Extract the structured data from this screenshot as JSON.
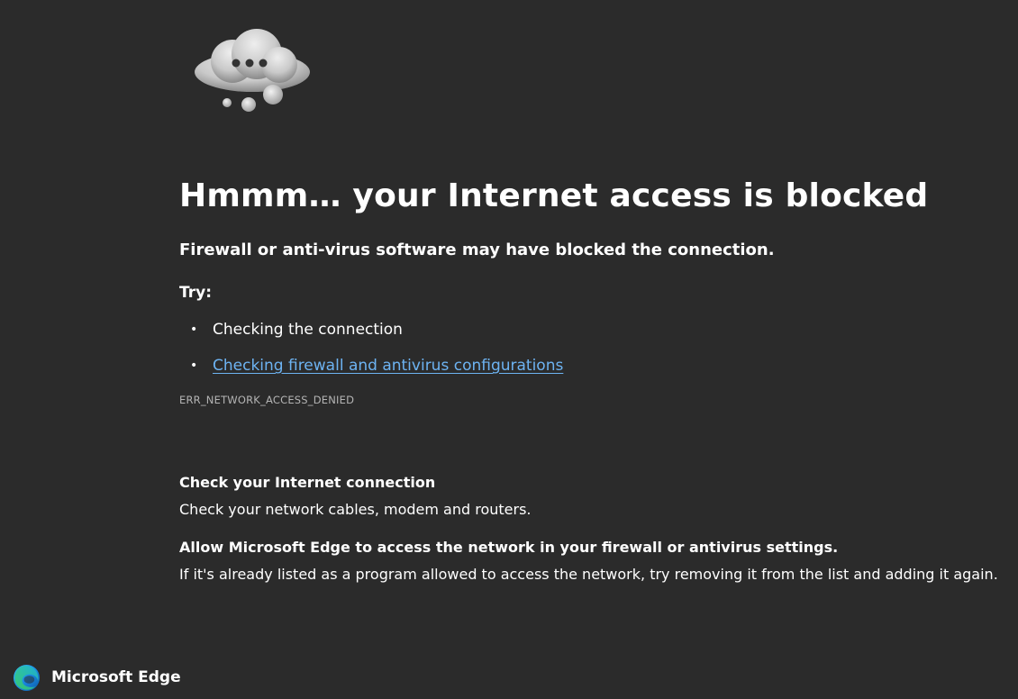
{
  "illustration": {
    "icon": "thinking-cloud-icon"
  },
  "main": {
    "headline": "Hmmm… your Internet access is blocked",
    "subtitle": "Firewall or anti-virus software may have blocked the connection.",
    "try_label": "Try:",
    "suggestions": [
      {
        "text": "Checking the connection",
        "is_link": false
      },
      {
        "text": "Checking firewall and antivirus configurations",
        "is_link": true
      }
    ],
    "error_code": "ERR_NETWORK_ACCESS_DENIED"
  },
  "help": [
    {
      "title": "Check your Internet connection",
      "text": "Check your network cables, modem and routers."
    },
    {
      "title": "Allow Microsoft Edge to access the network in your firewall or antivirus settings.",
      "text": "If it's already listed as a program allowed to access the network, try removing it from the list and adding it again."
    }
  ],
  "footer": {
    "brand_name": "Microsoft Edge",
    "logo_icon": "edge-logo-icon"
  },
  "colors": {
    "background": "#2b2b2b",
    "text": "#ffffff",
    "link": "#6db3f2",
    "muted": "#b4b4b4"
  }
}
